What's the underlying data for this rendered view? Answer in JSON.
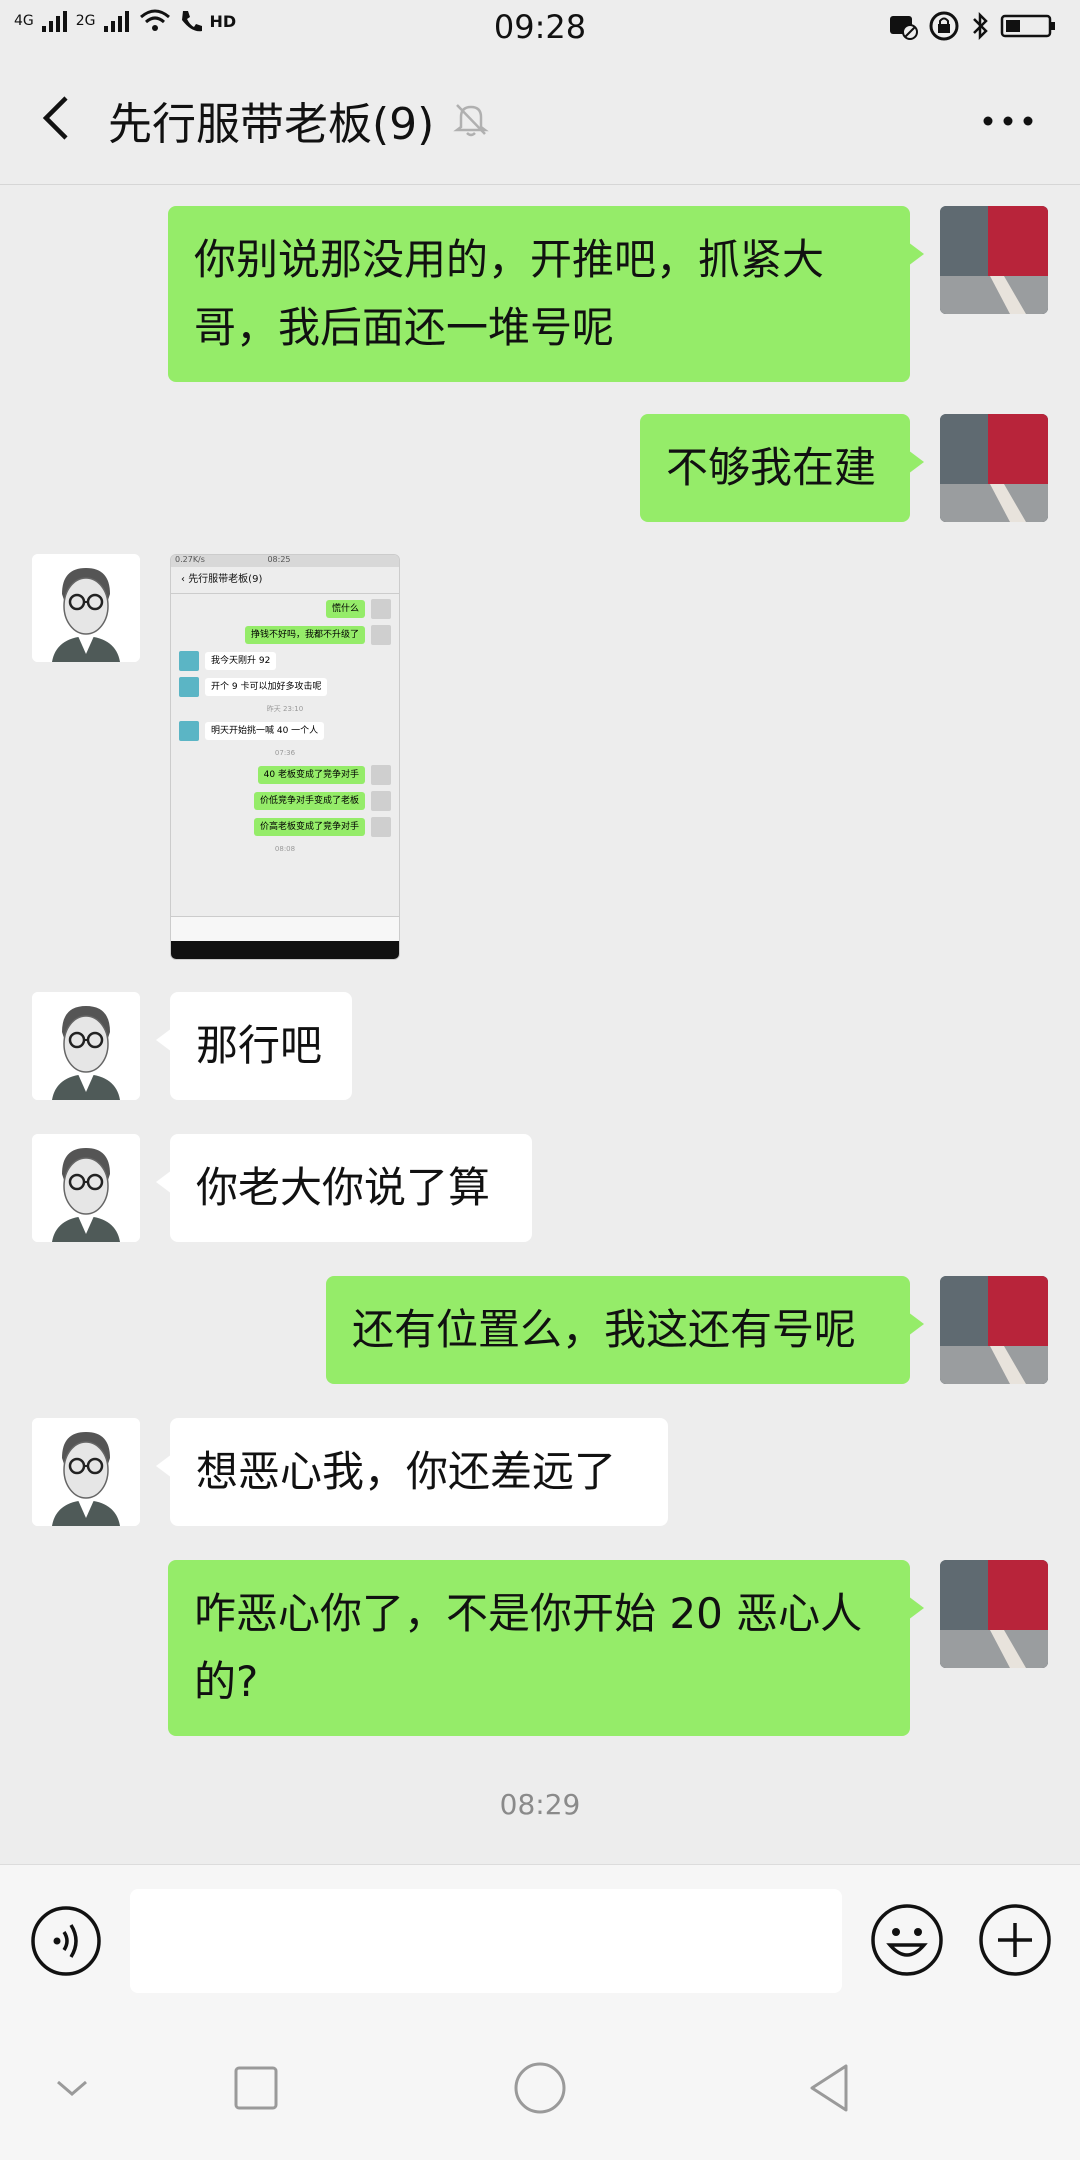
{
  "status_bar": {
    "signal_left": "4G",
    "signal_right": "2G",
    "hd": "HD",
    "time": "09:28"
  },
  "header": {
    "title": "先行服带老板(9)",
    "icons": [
      "back-icon",
      "mute-icon",
      "more-icon"
    ]
  },
  "messages": [
    {
      "side": "me",
      "text_lines": [
        "你别说那没用的，开推吧，抓紧大",
        "哥，我后面还一堆号呢"
      ]
    },
    {
      "side": "me",
      "text": "不够我在建"
    },
    {
      "side": "other",
      "type": "image"
    },
    {
      "side": "other",
      "text": "那行吧"
    },
    {
      "side": "other",
      "text": "你老大你说了算"
    },
    {
      "side": "me",
      "text": "还有位置么，我这还有号呢"
    },
    {
      "side": "other",
      "text": "想恶心我，你还差远了"
    },
    {
      "side": "me",
      "text_lines": [
        "咋恶心你了，不是你开始 20 恶心人",
        "的?"
      ]
    }
  ],
  "timestamp": "08:29",
  "thumbnail": {
    "status_left": "0.27K/s",
    "status_time": "08:25",
    "title": "先行服带老板(9)",
    "rows": [
      {
        "side": "me",
        "text": "慌什么"
      },
      {
        "side": "me",
        "text": "挣钱不好吗，我都不升级了"
      },
      {
        "side": "other",
        "text": "我今天刚升 92"
      },
      {
        "side": "other",
        "text": "开个 9 卡可以加好多攻击呢"
      },
      {
        "ts": "昨天 23:10"
      },
      {
        "side": "other",
        "text": "明天开始挑一喊 40 一个人"
      },
      {
        "ts": "07:36"
      },
      {
        "side": "me",
        "text": "40 老板变成了竞争对手"
      },
      {
        "side": "me",
        "text": "价低竞争对手变成了老板"
      },
      {
        "side": "me",
        "text": "价高老板变成了竞争对手"
      },
      {
        "ts": "08:08"
      }
    ]
  },
  "input_bar": {
    "placeholder": ""
  },
  "colors": {
    "my_bubble": "#95ec69",
    "background": "#ededed"
  }
}
